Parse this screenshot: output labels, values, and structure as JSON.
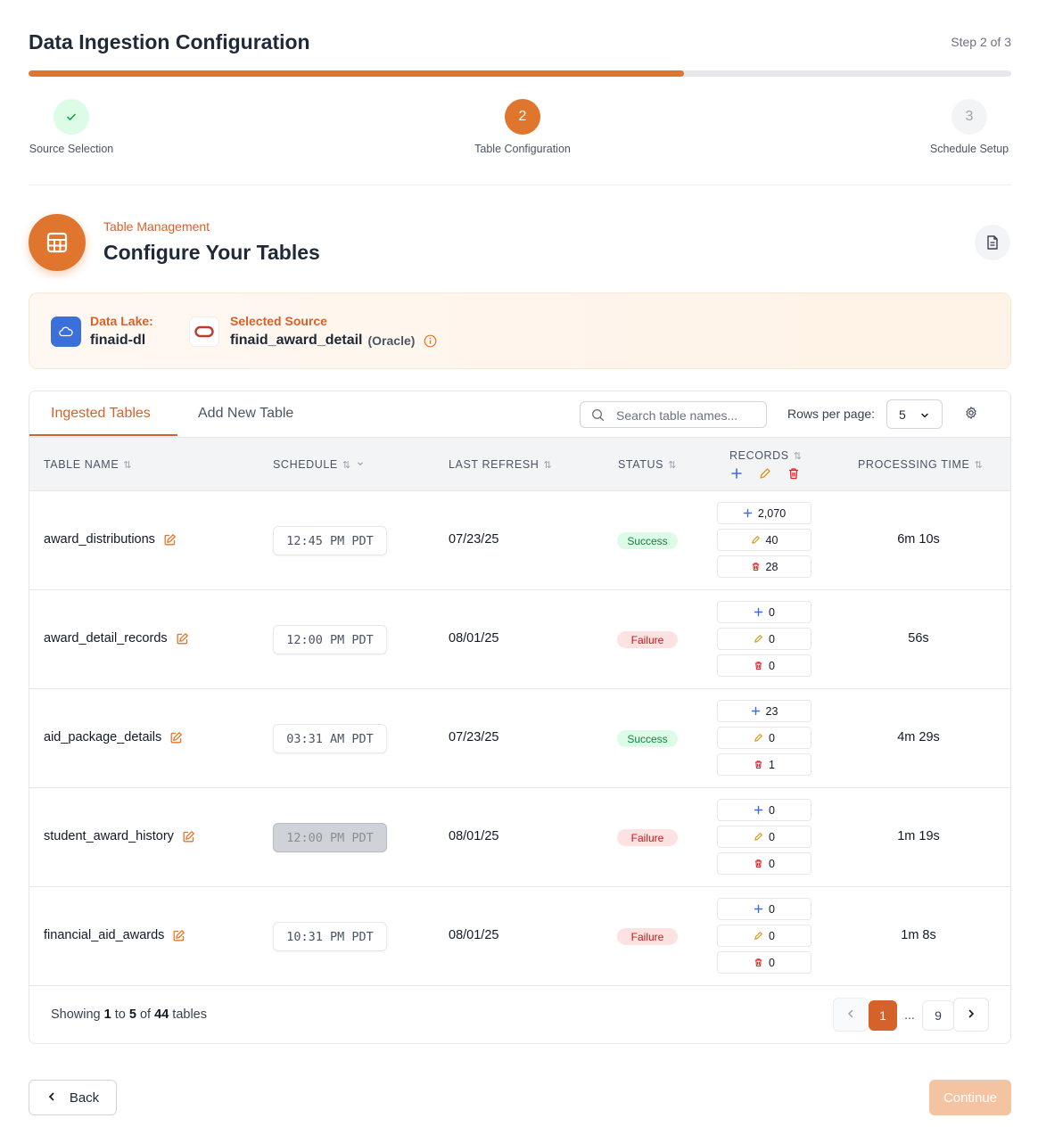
{
  "header": {
    "title": "Data Ingestion Configuration",
    "step_of": "Step 2 of 3",
    "progress_fraction": 0.667
  },
  "stepper": [
    {
      "label": "Source Selection",
      "number": "✓",
      "state": "done"
    },
    {
      "label": "Table Configuration",
      "number": "2",
      "state": "active"
    },
    {
      "label": "Schedule Setup",
      "number": "3",
      "state": "todo"
    }
  ],
  "section": {
    "eyebrow": "Table Management",
    "title": "Configure Your Tables",
    "icon": "table-icon"
  },
  "info": {
    "data_lake_label": "Data Lake:",
    "data_lake_value": "finaid-dl",
    "source_label": "Selected Source",
    "source_value": "finaid_award_detail",
    "source_type": "(Oracle)"
  },
  "tabs": {
    "ingested": "Ingested Tables",
    "add_new": "Add New Table"
  },
  "toolbar": {
    "search_placeholder": "Search table names...",
    "rows_per_page_label": "Rows per page:",
    "rows_per_page_value": "5"
  },
  "columns": {
    "table_name": "Table Name",
    "schedule": "Schedule",
    "last_refresh": "Last Refresh",
    "status": "Status",
    "records": "Records",
    "processing_time": "Processing Time"
  },
  "rows": [
    {
      "name": "award_distributions",
      "schedule": "12:45 PM PDT",
      "schedule_disabled": false,
      "last_refresh": "07/23/25",
      "status": "Success",
      "added": "2,070",
      "updated": "40",
      "deleted": "28",
      "processing_time": "6m 10s"
    },
    {
      "name": "award_detail_records",
      "schedule": "12:00 PM PDT",
      "schedule_disabled": false,
      "last_refresh": "08/01/25",
      "status": "Failure",
      "added": "0",
      "updated": "0",
      "deleted": "0",
      "processing_time": "56s"
    },
    {
      "name": "aid_package_details",
      "schedule": "03:31 AM PDT",
      "schedule_disabled": false,
      "last_refresh": "07/23/25",
      "status": "Success",
      "added": "23",
      "updated": "0",
      "deleted": "1",
      "processing_time": "4m 29s"
    },
    {
      "name": "student_award_history",
      "schedule": "12:00 PM PDT",
      "schedule_disabled": true,
      "last_refresh": "08/01/25",
      "status": "Failure",
      "added": "0",
      "updated": "0",
      "deleted": "0",
      "processing_time": "1m 19s"
    },
    {
      "name": "financial_aid_awards",
      "schedule": "10:31 PM PDT",
      "schedule_disabled": false,
      "last_refresh": "08/01/25",
      "status": "Failure",
      "added": "0",
      "updated": "0",
      "deleted": "0",
      "processing_time": "1m 8s"
    }
  ],
  "footer": {
    "showing_prefix": "Showing ",
    "from": "1",
    "to_word": " to ",
    "to": "5",
    "of_word": " of ",
    "total": "44",
    "suffix": " tables"
  },
  "pagination": {
    "current": "1",
    "ellipsis": "...",
    "last": "9"
  },
  "actions": {
    "back": "Back",
    "continue": "Continue"
  },
  "colors": {
    "accent": "#e0752e",
    "success_bg": "#dcfce7",
    "failure_bg": "#fee2e2"
  }
}
